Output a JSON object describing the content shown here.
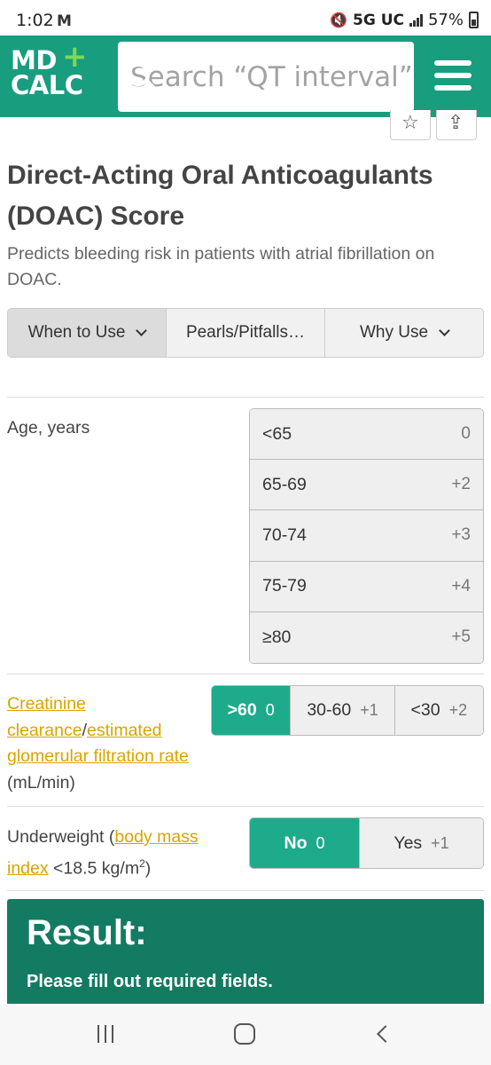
{
  "status_bar": {
    "time": "1:02",
    "mail_icon": "M",
    "network": "5G UC",
    "battery": "57%"
  },
  "header": {
    "logo_line1": "MD",
    "logo_line2": "CALC",
    "logo_plus": "+",
    "search_placeholder": "Search “QT interval”",
    "brand_color": "#199d7f",
    "search_button_color": "#f6b40e"
  },
  "actions": {
    "favorite_icon": "☆",
    "share_icon": "⇪"
  },
  "page": {
    "title": "Direct-Acting Oral Anticoagulants (DOAC) Score",
    "subtitle": "Predicts bleeding risk in patients with atrial fibrillation on DOAC."
  },
  "tabs": [
    {
      "label": "When to Use"
    },
    {
      "label": "Pearls/Pitfalls…"
    },
    {
      "label": "Why Use"
    }
  ],
  "age": {
    "label": "Age, years",
    "options": [
      {
        "label": "<65",
        "points": "0"
      },
      {
        "label": "65-69",
        "points": "+2"
      },
      {
        "label": "70-74",
        "points": "+3"
      },
      {
        "label": "75-79",
        "points": "+4"
      },
      {
        "label": "≥80",
        "points": "+5"
      }
    ]
  },
  "creatinine": {
    "link1": "Creatinine clearance",
    "separator": "/",
    "link2": "estimated glomerular filtration rate",
    "unit": " (mL/min)",
    "options": [
      {
        "label": ">60",
        "points": "0",
        "selected": true
      },
      {
        "label": "30-60",
        "points": "+1",
        "selected": false
      },
      {
        "label": "<30",
        "points": "+2",
        "selected": false
      }
    ]
  },
  "underweight": {
    "prefix": "Underweight (",
    "link": "body mass index",
    "suffix": " <18.5 kg/m",
    "superscript": "2",
    "close": ")",
    "options": [
      {
        "label": "No",
        "points": "0",
        "selected": true
      },
      {
        "label": "Yes",
        "points": "+1",
        "selected": false
      }
    ]
  },
  "result": {
    "title": "Result:",
    "message": "Please fill out required fields.",
    "color": "#137b61"
  },
  "selected_color": "#1eab8c",
  "link_color": "#d9a400"
}
